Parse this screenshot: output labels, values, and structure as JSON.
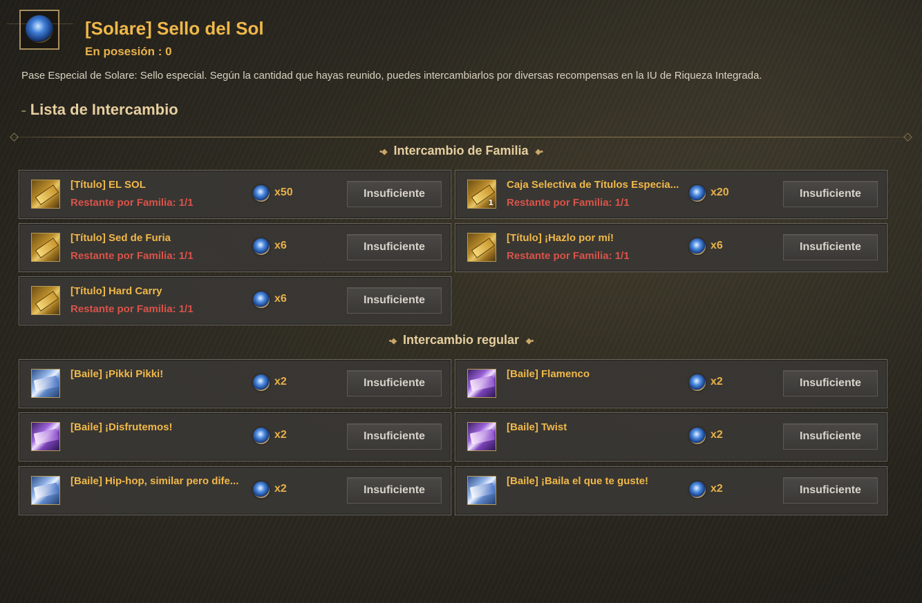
{
  "header": {
    "title": "[Solare] Sello del Sol",
    "possession": "En posesión : 0",
    "description": "Pase Especial de Solare: Sello especial. Según la cantidad que hayas reunido, puedes intercambiarlos por diversas recompensas en la IU de Riqueza Integrada."
  },
  "exchange_list_title": "Lista de Intercambio",
  "family_exchange": {
    "title": "Intercambio de Familia",
    "items": [
      {
        "name": "[Título] EL SOL",
        "limit": "Restante por Familia: 1/1",
        "cost": "x50",
        "button": "Insuficiente",
        "icon": "gold-title-ticket-icon"
      },
      {
        "name": "Caja Selectiva de Títulos Especia...",
        "limit": "Restante por Familia: 1/1",
        "cost": "x20",
        "button": "Insuficiente",
        "icon": "gold-title-box-icon",
        "count": "1"
      },
      {
        "name": "[Título] Sed de Furia",
        "limit": "Restante por Familia: 1/1",
        "cost": "x6",
        "button": "Insuficiente",
        "icon": "gold-title-ticket-icon"
      },
      {
        "name": "[Título] ¡Hazlo por mí!",
        "limit": "Restante por Familia: 1/1",
        "cost": "x6",
        "button": "Insuficiente",
        "icon": "gold-title-ticket-icon"
      },
      {
        "name": "[Título] Hard Carry",
        "limit": "Restante por Familia: 1/1",
        "cost": "x6",
        "button": "Insuficiente",
        "icon": "gold-title-ticket-icon"
      }
    ]
  },
  "regular_exchange": {
    "title": "Intercambio regular",
    "items": [
      {
        "name": "[Baile] ¡Pikki Pikki!",
        "cost": "x2",
        "button": "Insuficiente",
        "icon": "blue-dance-ticket-icon"
      },
      {
        "name": "[Baile] Flamenco",
        "cost": "x2",
        "button": "Insuficiente",
        "icon": "purple-dance-ticket-icon"
      },
      {
        "name": "[Baile] ¡Disfrutemos!",
        "cost": "x2",
        "button": "Insuficiente",
        "icon": "purple-dance-ticket-icon"
      },
      {
        "name": "[Baile] Twist",
        "cost": "x2",
        "button": "Insuficiente",
        "icon": "purple-dance-ticket-icon"
      },
      {
        "name": "[Baile] Hip-hop, similar pero dife...",
        "cost": "x2",
        "button": "Insuficiente",
        "icon": "blue-dance-ticket-icon"
      },
      {
        "name": "[Baile] ¡Baila el que te guste!",
        "cost": "x2",
        "button": "Insuficiente",
        "icon": "blue-dance-ticket-icon"
      }
    ]
  },
  "colors": {
    "accent_gold": "#f0b84a",
    "limit_red": "#d9534a",
    "card_bg": "#3a3734"
  }
}
